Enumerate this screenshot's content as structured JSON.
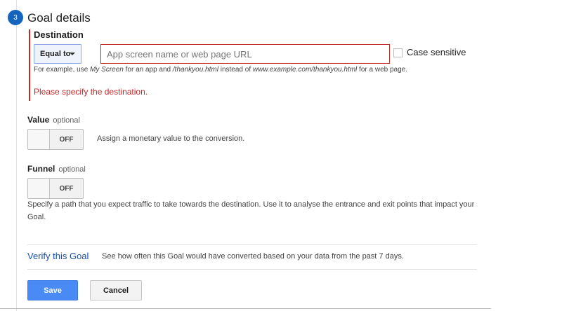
{
  "step": {
    "number": "3",
    "title": "Goal details"
  },
  "destination": {
    "label": "Destination",
    "match_type": "Equal to",
    "input_value": "",
    "input_placeholder": "App screen name or web page URL",
    "case_sensitive_label": "Case sensitive",
    "case_sensitive_checked": false,
    "hint": {
      "p1": "For example, use ",
      "e1": "My Screen",
      "p2": " for an app and ",
      "e2": "/thankyou.html",
      "p3": " instead of ",
      "e3": "www.example.com/thankyou.html",
      "p4": " for a web page."
    },
    "error": "Please specify the destination."
  },
  "value": {
    "label": "Value",
    "optional": "optional",
    "toggle_state": "OFF",
    "description": "Assign a monetary value to the conversion."
  },
  "funnel": {
    "label": "Funnel",
    "optional": "optional",
    "toggle_state": "OFF",
    "description": "Specify a path that you expect traffic to take towards the destination. Use it to analyse the entrance and exit points that impact your Goal."
  },
  "verify": {
    "link": "Verify this Goal",
    "description": "See how often this Goal would have converted based on your data from the past 7 days."
  },
  "actions": {
    "save": "Save",
    "cancel": "Cancel"
  },
  "colors": {
    "step_circle": "#1565c0",
    "error": "#c62828",
    "link": "#1a4fa8",
    "primary_button": "#4a8af4"
  }
}
